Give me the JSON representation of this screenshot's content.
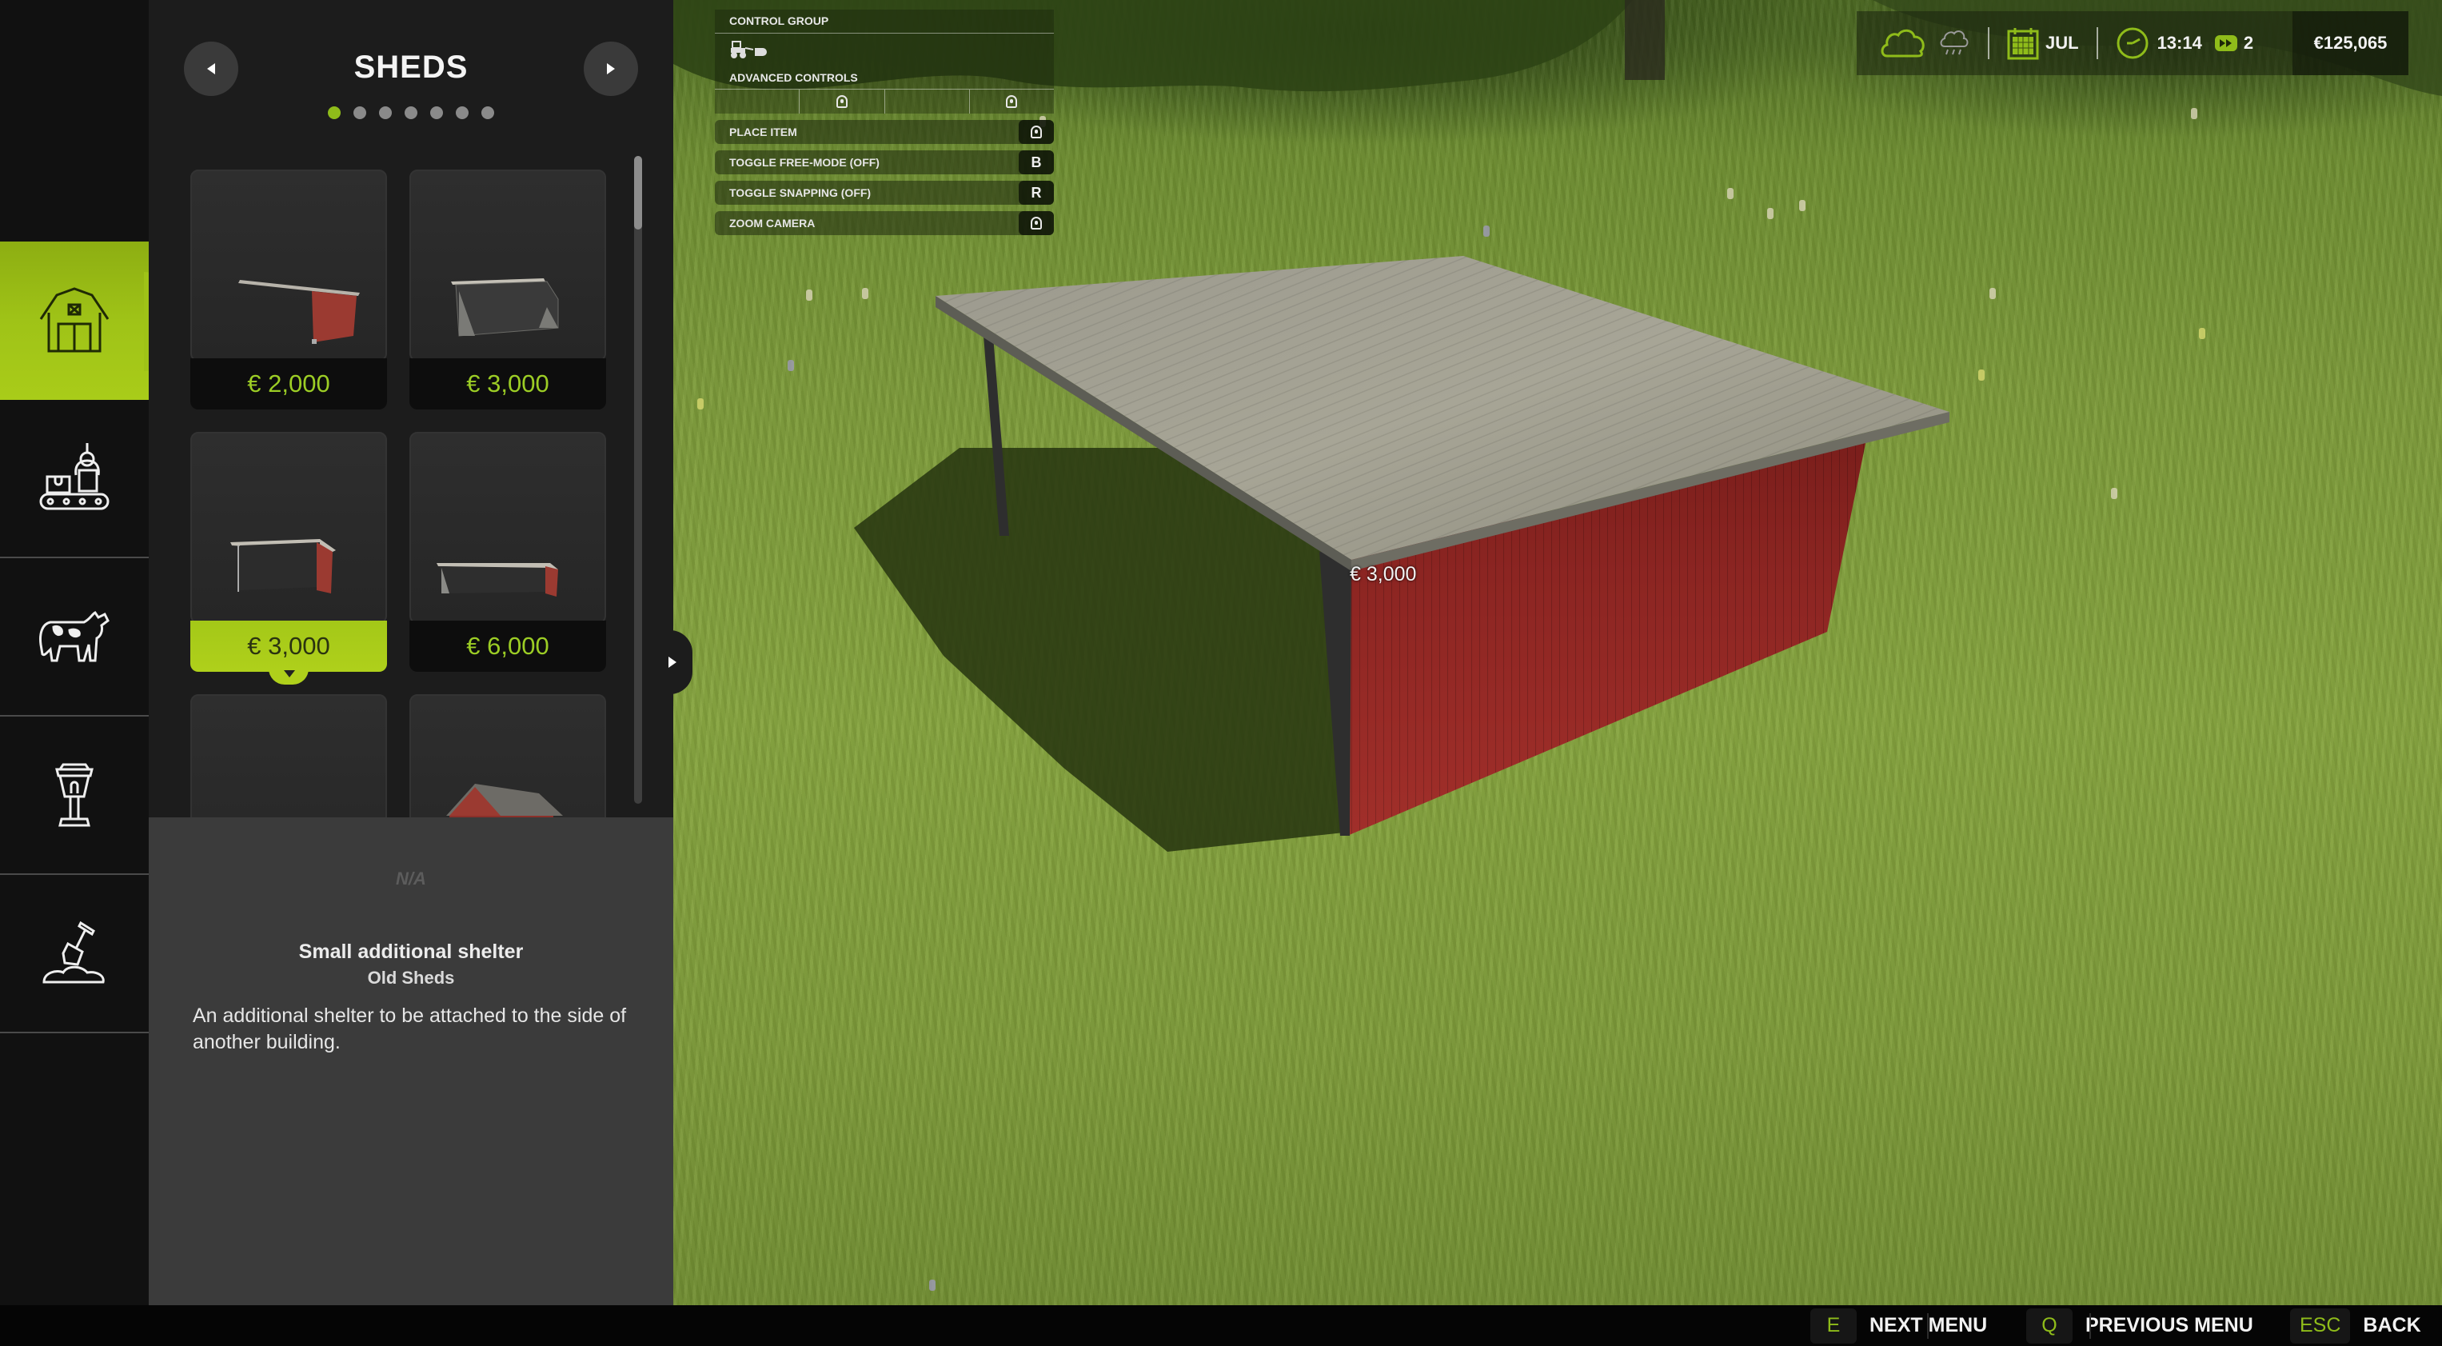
{
  "hud": {
    "controls": {
      "group_label": "CONTROL GROUP",
      "group_icon": "tractor-loader-icon",
      "advanced_label": "ADVANCED CONTROLS",
      "advanced_slots": [
        "",
        "mouse-icon",
        "",
        "mouse-icon"
      ],
      "actions": [
        {
          "label": "PLACE ITEM",
          "key": "",
          "key_icon": "mouse-left-click-icon"
        },
        {
          "label": "TOGGLE FREE-MODE (OFF)",
          "key": "B",
          "key_icon": ""
        },
        {
          "label": "TOGGLE SNAPPING (OFF)",
          "key": "R",
          "key_icon": ""
        },
        {
          "label": "ZOOM CAMERA",
          "key": "",
          "key_icon": "mouse-wheel-icon"
        }
      ]
    },
    "status": {
      "weather_now_icon": "cloud-icon",
      "weather_next_icon": "rain-cloud-icon",
      "month": "JUL",
      "time": "13:14",
      "time_speed": "2",
      "money": "€125,065",
      "accent_color": "#8fbc1a"
    }
  },
  "sidebar": {
    "items": [
      {
        "name": "buildings",
        "icon": "barn-icon",
        "active": true
      },
      {
        "name": "production",
        "icon": "production-conveyor-icon",
        "active": false
      },
      {
        "name": "animals",
        "icon": "cow-icon",
        "active": false
      },
      {
        "name": "decoration",
        "icon": "lamp-post-icon",
        "active": false
      },
      {
        "name": "landscaping",
        "icon": "shovel-icon",
        "active": false
      }
    ]
  },
  "catalog": {
    "title": "SHEDS",
    "page_count": 7,
    "current_page": 1,
    "items": [
      {
        "price": "€ 2,000",
        "preview": "red-lean-to-shed",
        "selected": false
      },
      {
        "price": "€ 3,000",
        "preview": "grey-open-shed",
        "selected": false
      },
      {
        "price": "€ 3,000",
        "preview": "small-additional-shelter",
        "selected": true
      },
      {
        "price": "€ 6,000",
        "preview": "long-open-shed",
        "selected": false
      },
      {
        "price": "",
        "preview": "empty",
        "selected": false
      },
      {
        "price": "",
        "preview": "red-gabled-shed",
        "selected": false
      }
    ],
    "scroll_position": 0.0
  },
  "details": {
    "na_label": "N/A",
    "name": "Small additional shelter",
    "category": "Old Sheds",
    "description": "An additional shelter to be attached to the side of another building."
  },
  "world": {
    "placement_price": "€ 3,000"
  },
  "keybar": {
    "hints": [
      {
        "key": "E",
        "label": "NEXT MENU"
      },
      {
        "key": "Q",
        "label": "PREVIOUS MENU"
      },
      {
        "key": "ESC",
        "label": "BACK"
      }
    ]
  }
}
